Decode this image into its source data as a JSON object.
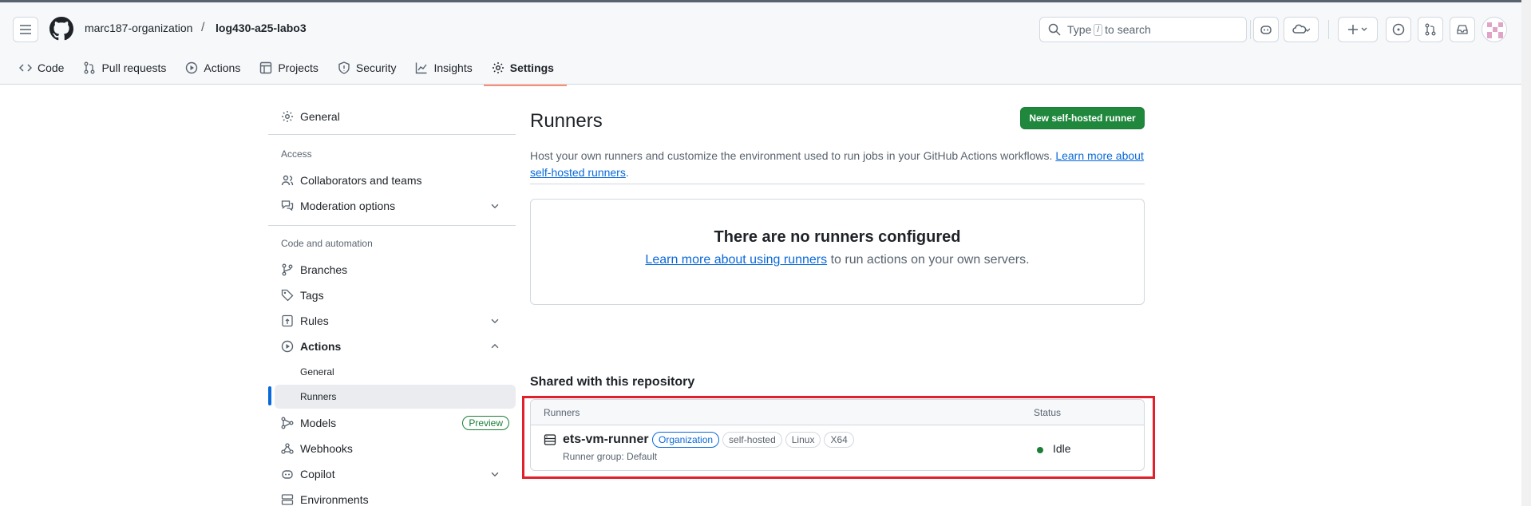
{
  "header": {
    "owner": "marc187-organization",
    "separator": "/",
    "repo": "log430-a25-labo3",
    "search": {
      "prefix": "Type",
      "key": "/",
      "suffix": "to search"
    }
  },
  "tabs": [
    {
      "label": "Code",
      "icon": "code-icon"
    },
    {
      "label": "Pull requests",
      "icon": "pull-request-icon"
    },
    {
      "label": "Actions",
      "icon": "play-icon"
    },
    {
      "label": "Projects",
      "icon": "table-icon"
    },
    {
      "label": "Security",
      "icon": "shield-icon"
    },
    {
      "label": "Insights",
      "icon": "graph-icon"
    },
    {
      "label": "Settings",
      "icon": "gear-icon",
      "active": true
    }
  ],
  "sidebar": {
    "general": "General",
    "access_heading": "Access",
    "collaborators": "Collaborators and teams",
    "moderation": "Moderation options",
    "code_heading": "Code and automation",
    "branches": "Branches",
    "tags": "Tags",
    "rules": "Rules",
    "actions": "Actions",
    "actions_general": "General",
    "actions_runners": "Runners",
    "models": "Models",
    "models_badge": "Preview",
    "webhooks": "Webhooks",
    "copilot": "Copilot",
    "environments": "Environments"
  },
  "main": {
    "title": "Runners",
    "new_button": "New self-hosted runner",
    "description": "Host your own runners and customize the environment used to run jobs in your GitHub Actions workflows.",
    "learn_more_link": "Learn more about self-hosted runners",
    "period": ".",
    "empty_title": "There are no runners configured",
    "empty_link": "Learn more about using runners",
    "empty_text": " to run actions on your own servers.",
    "shared_title": "Shared with this repository",
    "table": {
      "col_runners": "Runners",
      "col_status": "Status",
      "rows": [
        {
          "name": "ets-vm-runner",
          "labels": [
            "Organization",
            "self-hosted",
            "Linux",
            "X64"
          ],
          "group": "Runner group: Default",
          "status": "Idle"
        }
      ]
    }
  },
  "colors": {
    "accent": "#0969da",
    "primary_button": "#1f883d",
    "status_idle": "#1a7f37",
    "highlight_box": "#e0202a",
    "active_tab_underline": "#fd8c73"
  }
}
